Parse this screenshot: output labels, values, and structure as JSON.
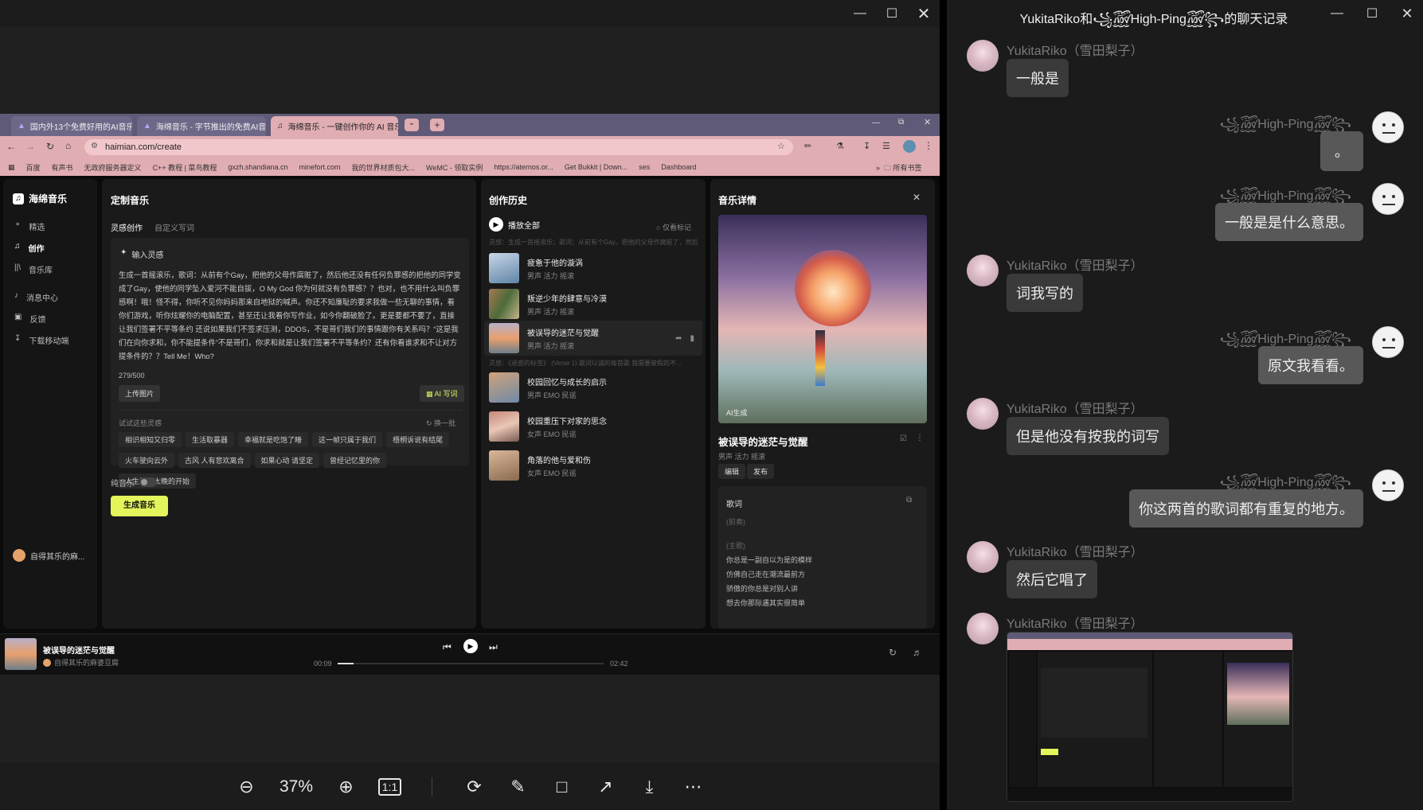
{
  "viewer": {
    "zoom_label": "37%",
    "actual_size_label": "1:1",
    "window_controls": [
      "minimize",
      "maximize",
      "close"
    ]
  },
  "browser": {
    "tabs": [
      {
        "label": "国内外13个免费好用的AI音乐生成",
        "active": false
      },
      {
        "label": "海绵音乐 - 字节推出的免费AI音乐",
        "active": false
      },
      {
        "label": "海绵音乐 - 一键创作你的 AI 音乐",
        "active": true
      }
    ],
    "url": "haimian.com/create",
    "bookmarks": [
      "百度",
      "有声书",
      "无政府服务器定义",
      "C++ 教程 | 菜鸟教程",
      "gxzh.shandiana.cn",
      "minefort.com",
      "我的世界材质包大...",
      "WeMC - 领取实例",
      "https://aternos.or...",
      "Get Bukkit | Down...",
      "ses",
      "Dashboard"
    ],
    "bookmarks_all": "所有书签"
  },
  "app": {
    "brand": "海绵音乐",
    "nav": [
      "精选",
      "创作",
      "音乐库"
    ],
    "nav2": [
      "消息中心",
      "反馈",
      "下载移动端"
    ],
    "user": "自得其乐的麻...",
    "custom": {
      "title": "定制音乐",
      "tab_inspiration": "灵感创作",
      "tab_custom": "自定义写词",
      "input_label": "输入灵感",
      "prompt_text": "生成一首摇滚乐，歌词：从前有个Gay，把他的父母作腐赃了，然后他还没有任何负罪感的把他的同学变成了Gay，使他的同学坠入爱河不能自拔，O My God 你为何就没有负罪感？？也对，也不用什么叫负罪感啊！哦！怪不得，你听不见你妈妈那来自地狱的喊声。你还不知廉耻的要求我做一些无聊的事情，看你们游戏，听你炫耀你的电脑配置，甚至还让我看你写作业，如今你翻破脸了。更是要都不要了，直接让我们签署不平等条约 还说如果我们不签求压测，DDOS，不是哥们我们的事情跟你有关系吗？“这是我们在向你求和，你不能提条件”不是哥们，你求和就是让我们签署不平等条约？还有你看谁求和不让对方提条件的？？Tell Me！Who?",
      "char_count": "279/500",
      "upload_btn": "上传图片",
      "ai_lyrics_btn": "AI 写词",
      "suggest_label": "试试这些灵感",
      "refresh_label": "换一批",
      "chips": [
        "相识相知又归零",
        "生活取暴器",
        "幸福就是吃饱了睡",
        "这一帧只属于我们",
        "梧桐诉说有结尾",
        "火车驶向云外",
        "古风 人有悲欢离合",
        "如果心动 请坚定",
        "曾经记忆里的你",
        "人生没有太晚的开始"
      ],
      "pure_music": "纯音乐",
      "generate_btn": "生成音乐"
    },
    "history": {
      "title": "创作历史",
      "play_all": "播放全部",
      "tag_only": "仅看标记",
      "group1_caption": "灵感：生成一首摇滚乐；歌词：从前有个Gay。把他的父母作腐赃了，然后...",
      "group2_caption": "灵感：《迷惑的标签》 (Verse 1) 歌词以诚的每首歌 我需要被假的不...",
      "items": [
        {
          "title": "疲惫于他的漩涡",
          "tags": "男声 活力 摇滚"
        },
        {
          "title": "叛逆少年的肆意与冷漠",
          "tags": "男声 活力 摇滚"
        },
        {
          "title": "被误导的迷茫与觉醒",
          "tags": "男声 活力 摇滚"
        },
        {
          "title": "校园回忆与成长的启示",
          "tags": "男声 EMO 民谣"
        },
        {
          "title": "校园重压下对家的思念",
          "tags": "女声 EMO 民谣"
        },
        {
          "title": "角落的他与爱和伤",
          "tags": "女声 EMO 民谣"
        }
      ]
    },
    "detail": {
      "title": "音乐详情",
      "song_title": "被误导的迷茫与觉醒",
      "tags": "男声 活力 摇滚",
      "ai_badge": "AI生成",
      "edit_btn": "编辑",
      "publish_btn": "发布",
      "lyrics_label": "歌词",
      "lyrics": [
        "(前奏)",
        "",
        "(主歌)",
        "你总是一副自以为是的模样",
        "仿佛自己走在潮流最前方",
        "骄傲的你总是对别人讲",
        "想去你那际遇其实很简单"
      ]
    },
    "player": {
      "song": "被误导的迷茫与觉醒",
      "artist": "自得其乐的麻婆豆腐",
      "current": "00:09",
      "total": "02:42",
      "progress": 0.06
    }
  },
  "chat": {
    "title": "YukitaRiko和꧁꫞High-Ping꫞꧂的聊天记录",
    "messages": [
      {
        "sender": "YukitaRiko（雪田梨子）",
        "side": "left",
        "text": "一般是"
      },
      {
        "sender": "꧁꫞High-Ping꫞꧂",
        "side": "right",
        "text": "。"
      },
      {
        "sender": "꧁꫞High-Ping꫞꧂",
        "side": "right",
        "text": "一般是是什么意思。"
      },
      {
        "sender": "YukitaRiko（雪田梨子）",
        "side": "left",
        "text": "词我写的"
      },
      {
        "sender": "꧁꫞High-Ping꫞꧂",
        "side": "right",
        "text": "原文我看看。"
      },
      {
        "sender": "YukitaRiko（雪田梨子）",
        "side": "left",
        "text": "但是他没有按我的词写"
      },
      {
        "sender": "꧁꫞High-Ping꫞꧂",
        "side": "right",
        "text": "你这两首的歌词都有重复的地方。"
      },
      {
        "sender": "YukitaRiko（雪田梨子）",
        "side": "left",
        "text": "然后它唱了"
      },
      {
        "sender": "YukitaRiko（雪田梨子）",
        "side": "left",
        "text": ""
      }
    ]
  }
}
